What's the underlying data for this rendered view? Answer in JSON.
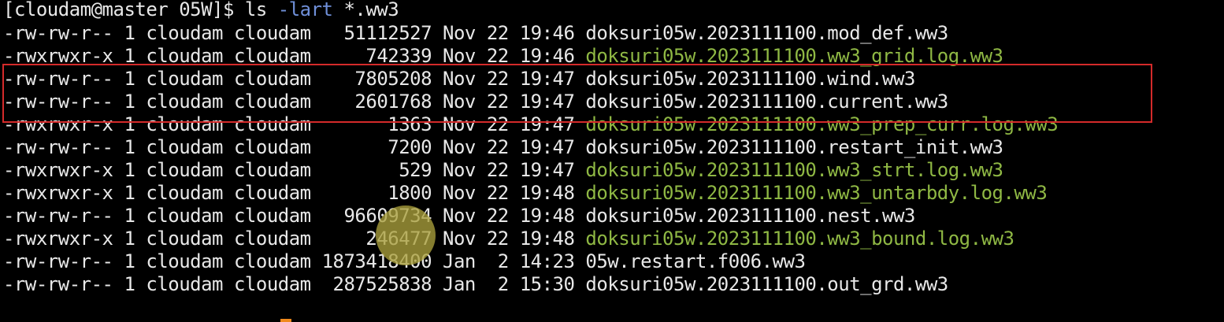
{
  "terminal": {
    "prompt": "[cloudam@master 05W]$ ",
    "command": "ls",
    "option": "-lart",
    "argument": "*.ww3",
    "rows": [
      {
        "perms": "-rw-rw-r--",
        "links": "1",
        "owner": "cloudam",
        "group": "cloudam",
        "size": "51112527",
        "month": "Nov",
        "day": "22",
        "time": "19:46",
        "name": "doksuri05w.2023111100.mod_def.ww3",
        "exec": false
      },
      {
        "perms": "-rwxrwxr-x",
        "links": "1",
        "owner": "cloudam",
        "group": "cloudam",
        "size": "742339",
        "month": "Nov",
        "day": "22",
        "time": "19:46",
        "name": "doksuri05w.2023111100.ww3_grid.log.ww3",
        "exec": true
      },
      {
        "perms": "-rw-rw-r--",
        "links": "1",
        "owner": "cloudam",
        "group": "cloudam",
        "size": "7805208",
        "month": "Nov",
        "day": "22",
        "time": "19:47",
        "name": "doksuri05w.2023111100.wind.ww3",
        "exec": false
      },
      {
        "perms": "-rw-rw-r--",
        "links": "1",
        "owner": "cloudam",
        "group": "cloudam",
        "size": "2601768",
        "month": "Nov",
        "day": "22",
        "time": "19:47",
        "name": "doksuri05w.2023111100.current.ww3",
        "exec": false
      },
      {
        "perms": "-rwxrwxr-x",
        "links": "1",
        "owner": "cloudam",
        "group": "cloudam",
        "size": "1363",
        "month": "Nov",
        "day": "22",
        "time": "19:47",
        "name": "doksuri05w.2023111100.ww3_prep_curr.log.ww3",
        "exec": true
      },
      {
        "perms": "-rw-rw-r--",
        "links": "1",
        "owner": "cloudam",
        "group": "cloudam",
        "size": "7200",
        "month": "Nov",
        "day": "22",
        "time": "19:47",
        "name": "doksuri05w.2023111100.restart_init.ww3",
        "exec": false
      },
      {
        "perms": "-rwxrwxr-x",
        "links": "1",
        "owner": "cloudam",
        "group": "cloudam",
        "size": "529",
        "month": "Nov",
        "day": "22",
        "time": "19:47",
        "name": "doksuri05w.2023111100.ww3_strt.log.ww3",
        "exec": true
      },
      {
        "perms": "-rwxrwxr-x",
        "links": "1",
        "owner": "cloudam",
        "group": "cloudam",
        "size": "1800",
        "month": "Nov",
        "day": "22",
        "time": "19:48",
        "name": "doksuri05w.2023111100.ww3_untarbdy.log.ww3",
        "exec": true
      },
      {
        "perms": "-rw-rw-r--",
        "links": "1",
        "owner": "cloudam",
        "group": "cloudam",
        "size": "96609734",
        "month": "Nov",
        "day": "22",
        "time": "19:48",
        "name": "doksuri05w.2023111100.nest.ww3",
        "exec": false
      },
      {
        "perms": "-rwxrwxr-x",
        "links": "1",
        "owner": "cloudam",
        "group": "cloudam",
        "size": "246477",
        "month": "Nov",
        "day": "22",
        "time": "19:48",
        "name": "doksuri05w.2023111100.ww3_bound.log.ww3",
        "exec": true
      },
      {
        "perms": "-rw-rw-r--",
        "links": "1",
        "owner": "cloudam",
        "group": "cloudam",
        "size": "1873418400",
        "month": "Jan",
        "day": "2",
        "time": "14:23",
        "name": "05w.restart.f006.ww3",
        "exec": false
      },
      {
        "perms": "-rw-rw-r--",
        "links": "1",
        "owner": "cloudam",
        "group": "cloudam",
        "size": "287525838",
        "month": "Jan",
        "day": "2",
        "time": "15:30",
        "name": "doksuri05w.2023111100.out_grd.ww3",
        "exec": false
      }
    ]
  },
  "colors": {
    "background": "#000000",
    "text": "#e8e8e8",
    "executable": "#8fb844",
    "option": "#6f8fd8",
    "highlight_box": "#d42a2a",
    "cursor_dot": "#aaa03c"
  }
}
